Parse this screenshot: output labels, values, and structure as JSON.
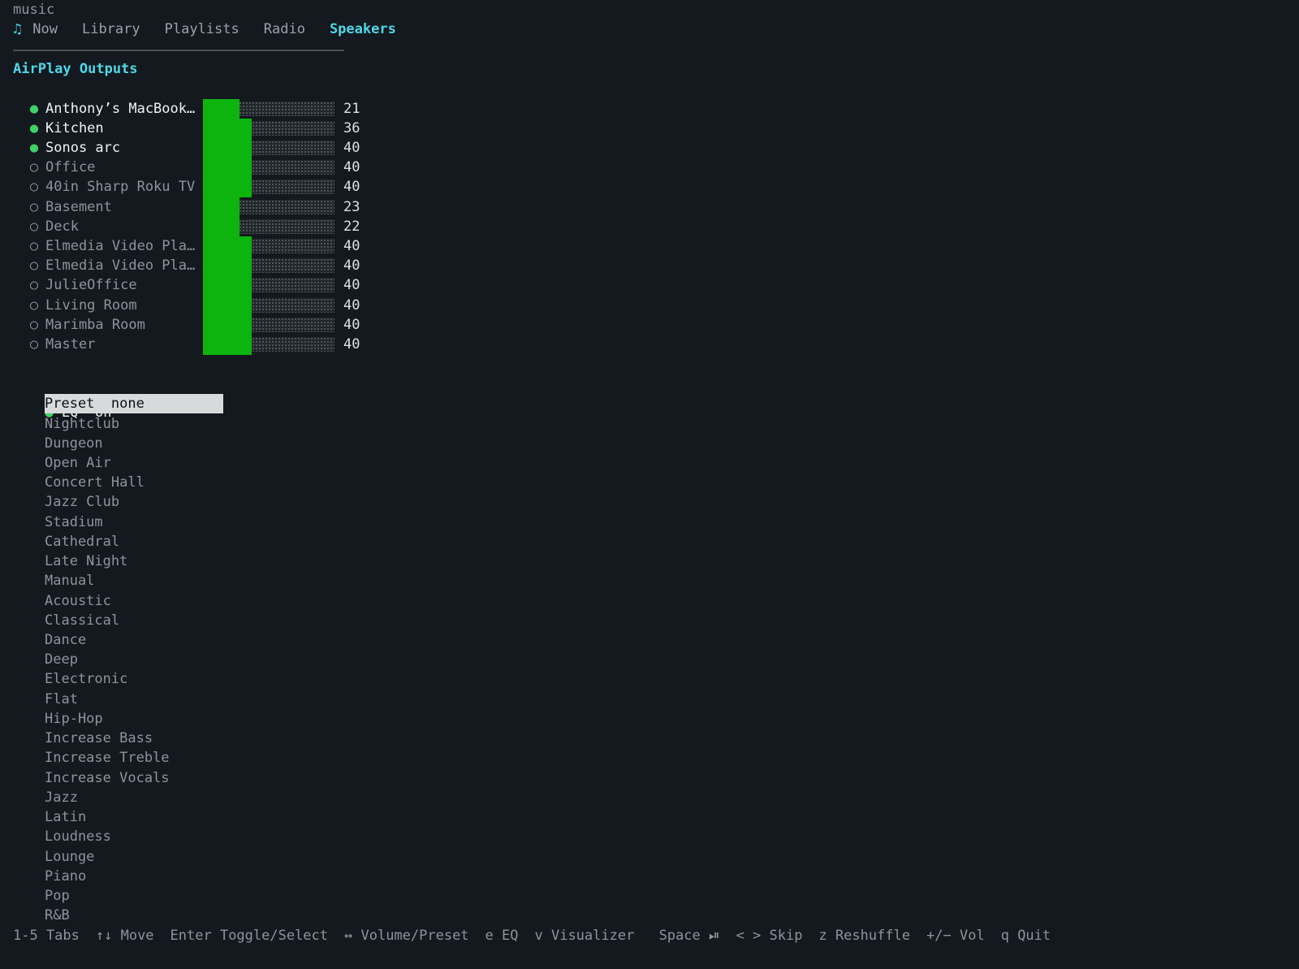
{
  "app": {
    "title": "music",
    "note_glyph": "♫"
  },
  "tabs": [
    {
      "label": "Now",
      "active": false
    },
    {
      "label": "Library",
      "active": false
    },
    {
      "label": "Playlists",
      "active": false
    },
    {
      "label": "Radio",
      "active": false
    },
    {
      "label": "Speakers",
      "active": true
    }
  ],
  "section": {
    "title": "AirPlay Outputs"
  },
  "devices": [
    {
      "name": "Anthony’s MacBook…",
      "active": true,
      "volume": 21
    },
    {
      "name": "Kitchen",
      "active": true,
      "volume": 36
    },
    {
      "name": "Sonos arc",
      "active": true,
      "volume": 40
    },
    {
      "name": "Office",
      "active": false,
      "volume": 40
    },
    {
      "name": "40in Sharp Roku TV",
      "active": false,
      "volume": 40
    },
    {
      "name": "Basement",
      "active": false,
      "volume": 23
    },
    {
      "name": "Deck",
      "active": false,
      "volume": 22
    },
    {
      "name": "Elmedia Video Pla…",
      "active": false,
      "volume": 40
    },
    {
      "name": "Elmedia Video Pla…",
      "active": false,
      "volume": 40
    },
    {
      "name": "JulieOffice",
      "active": false,
      "volume": 40
    },
    {
      "name": "Living Room",
      "active": false,
      "volume": 40
    },
    {
      "name": "Marimba Room",
      "active": false,
      "volume": 40
    },
    {
      "name": "Master",
      "active": false,
      "volume": 40
    }
  ],
  "eq": {
    "label": "EQ",
    "state": "on",
    "preset_label": "Preset",
    "preset_value": "none",
    "presets": [
      "Nightclub",
      "Dungeon",
      "Open Air",
      "Concert Hall",
      "Jazz Club",
      "Stadium",
      "Cathedral",
      "Late Night",
      "Manual",
      "Acoustic",
      "Classical",
      "Dance",
      "Deep",
      "Electronic",
      "Flat",
      "Hip-Hop",
      "Increase Bass",
      "Increase Treble",
      "Increase Vocals",
      "Jazz",
      "Latin",
      "Loudness",
      "Lounge",
      "Piano",
      "Pop",
      "R&B"
    ]
  },
  "footer": {
    "hints": [
      "1-5 Tabs",
      "↑↓ Move",
      "Enter Toggle/Select",
      "↔ Volume/Preset",
      "e EQ",
      "v Visualizer ",
      "Space ⏯",
      "< > Skip",
      "z Reshuffle",
      "+/− Vol",
      "q Quit"
    ]
  },
  "colors": {
    "background": "#13191e",
    "accent": "#4ed8e8",
    "active_dot": "#3ed26a",
    "volume_fill": "#0db40d"
  }
}
